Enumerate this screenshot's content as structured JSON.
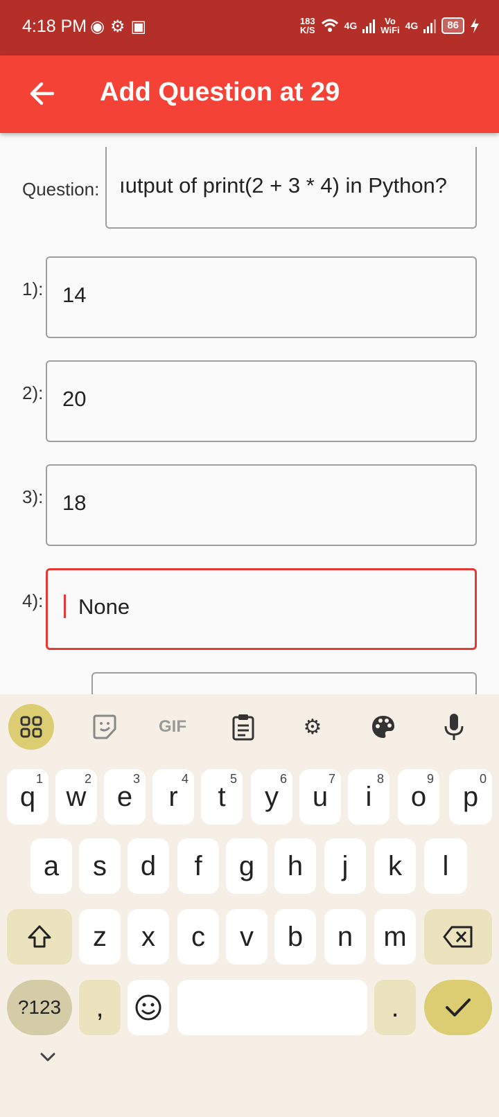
{
  "status_bar": {
    "time": "4:18 PM",
    "net_speed_value": "183",
    "net_speed_unit": "K/S",
    "network1": "4G",
    "volte_top": "Vo",
    "volte_bottom": "WiFi",
    "network2": "4G",
    "battery": "86"
  },
  "app_bar": {
    "title": "Add Question at 29"
  },
  "form": {
    "question_label": "Question:",
    "question_value": "ıutput of print(2 + 3 * 4) in Python?",
    "options": [
      {
        "label": "1):",
        "value": "14"
      },
      {
        "label": "2):",
        "value": "20"
      },
      {
        "label": "3):",
        "value": "18"
      },
      {
        "label": "4):",
        "value": "None"
      }
    ]
  },
  "keyboard": {
    "toolbar": [
      "apps-icon",
      "sticker-icon",
      "GIF",
      "clipboard-icon",
      "settings-icon",
      "palette-icon",
      "mic-icon"
    ],
    "gif_label": "GIF",
    "row1": [
      {
        "key": "q",
        "hint": "1"
      },
      {
        "key": "w",
        "hint": "2"
      },
      {
        "key": "e",
        "hint": "3"
      },
      {
        "key": "r",
        "hint": "4"
      },
      {
        "key": "t",
        "hint": "5"
      },
      {
        "key": "y",
        "hint": "6"
      },
      {
        "key": "u",
        "hint": "7"
      },
      {
        "key": "i",
        "hint": "8"
      },
      {
        "key": "o",
        "hint": "9"
      },
      {
        "key": "p",
        "hint": "0"
      }
    ],
    "row2": [
      "a",
      "s",
      "d",
      "f",
      "g",
      "h",
      "j",
      "k",
      "l"
    ],
    "row3": [
      "z",
      "x",
      "c",
      "v",
      "b",
      "n",
      "m"
    ],
    "sym_label": "?123",
    "comma": ",",
    "period": "."
  }
}
